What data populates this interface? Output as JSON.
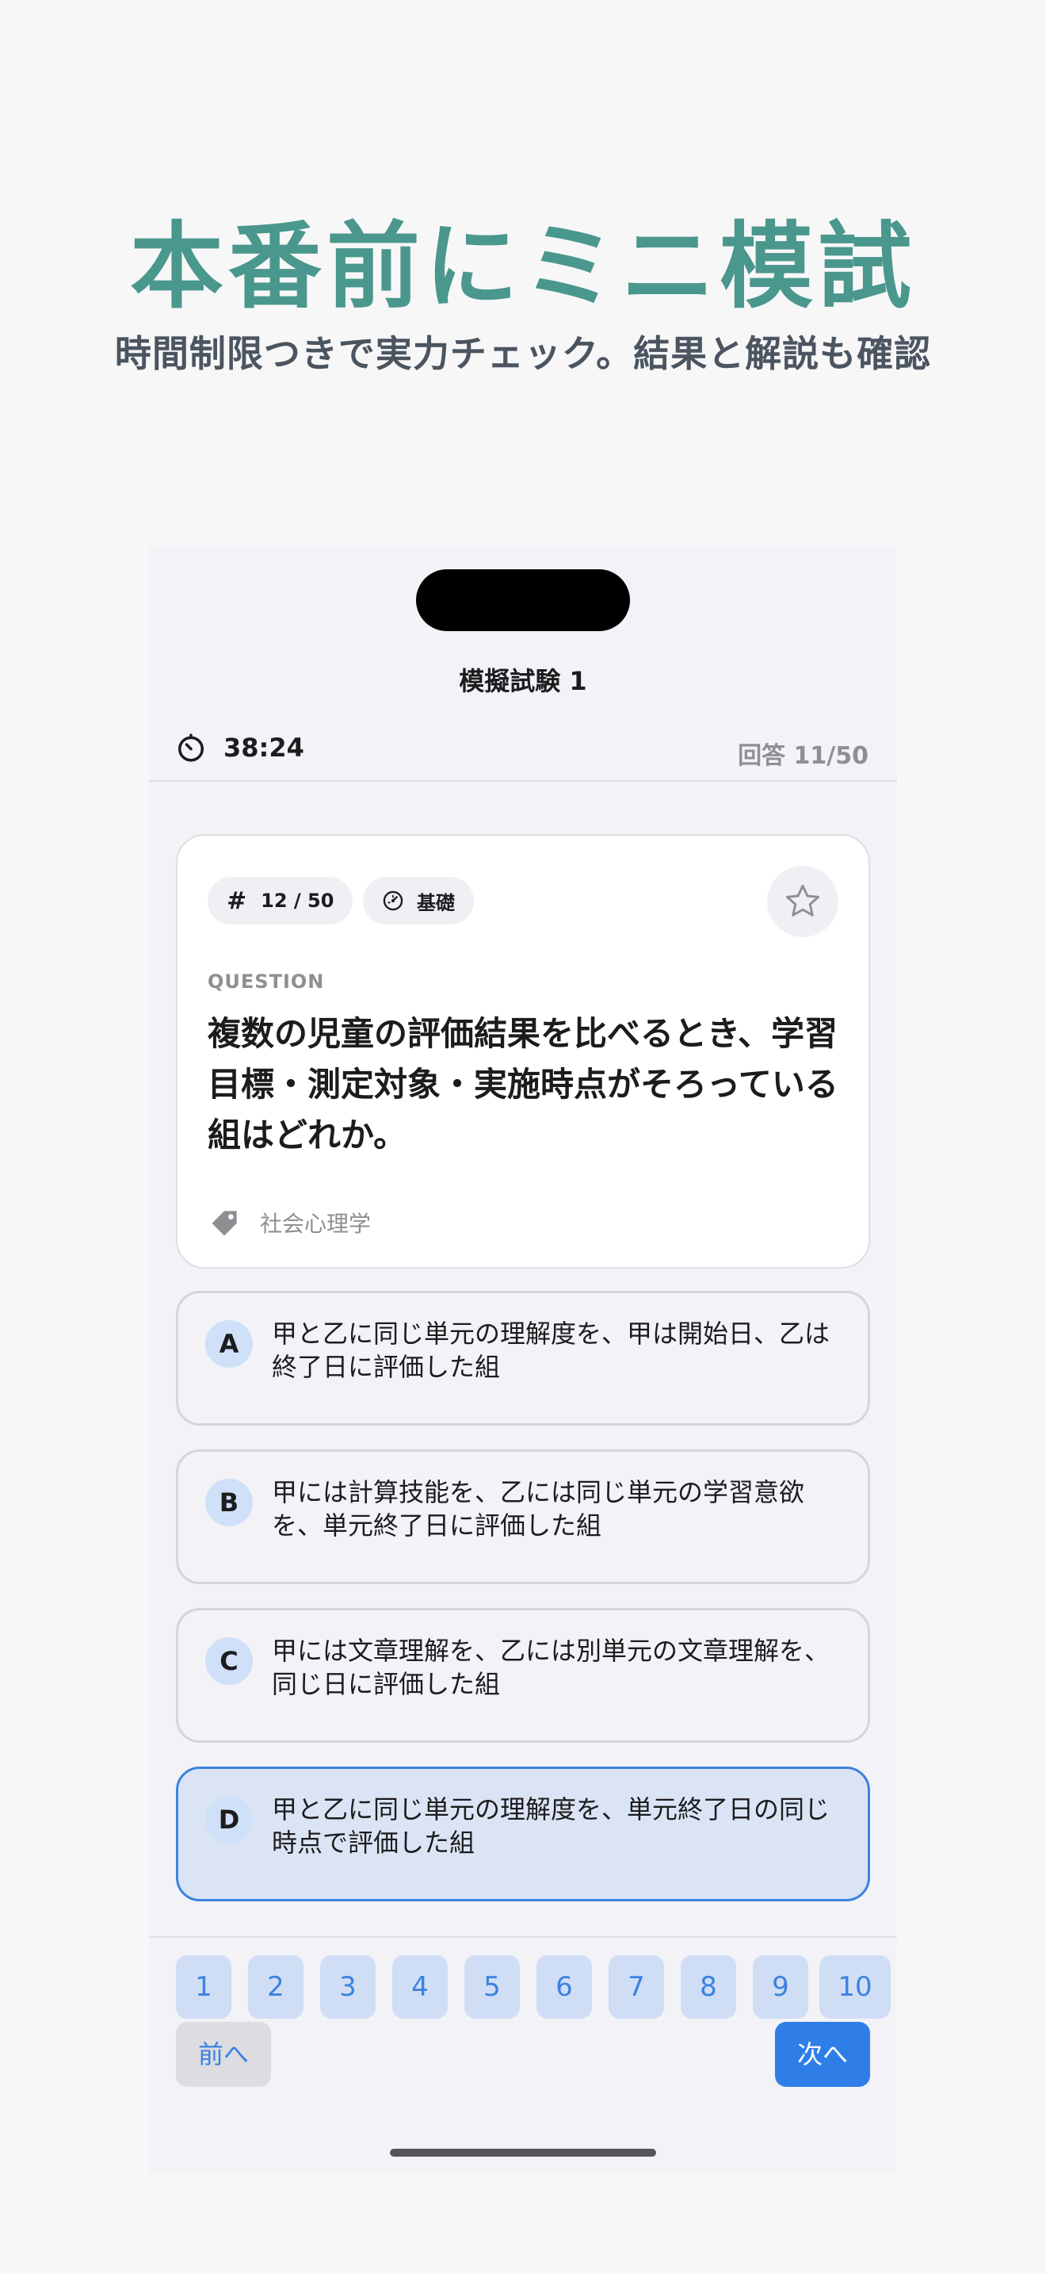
{
  "promo": {
    "headline": "本番前にミニ模試",
    "subheadline": "時間制限つきで実力チェック。結果と解説も確認"
  },
  "nav": {
    "title": "模擬試験 1"
  },
  "status": {
    "timer": "38:24",
    "answered": "回答 11/50"
  },
  "question": {
    "number": "12 / 50",
    "level": "基礎",
    "label": "QUESTION",
    "text": "複数の児童の評価結果を比べるとき、学習目標・測定対象・実施時点がそろっている組はどれか。",
    "tag": "社会心理学",
    "bookmarked": false
  },
  "options": [
    {
      "letter": "A",
      "text": "甲と乙に同じ単元の理解度を、甲は開始日、乙は終了日に評価した組",
      "selected": false
    },
    {
      "letter": "B",
      "text": "甲には計算技能を、乙には同じ単元の学習意欲を、単元終了日に評価した組",
      "selected": false
    },
    {
      "letter": "C",
      "text": "甲には文章理解を、乙には別単元の文章理解を、同じ日に評価した組",
      "selected": false
    },
    {
      "letter": "D",
      "text": "甲と乙に同じ単元の理解度を、単元終了日の同じ時点で評価した組",
      "selected": true
    }
  ],
  "question_nav": [
    "1",
    "2",
    "3",
    "4",
    "5",
    "6",
    "7",
    "8",
    "9",
    "10"
  ],
  "buttons": {
    "prev": "前へ",
    "next": "次へ"
  },
  "colors": {
    "accent": "#2f7ee8",
    "headline": "#4a978d",
    "selected_bg": "#dbe4f4"
  }
}
